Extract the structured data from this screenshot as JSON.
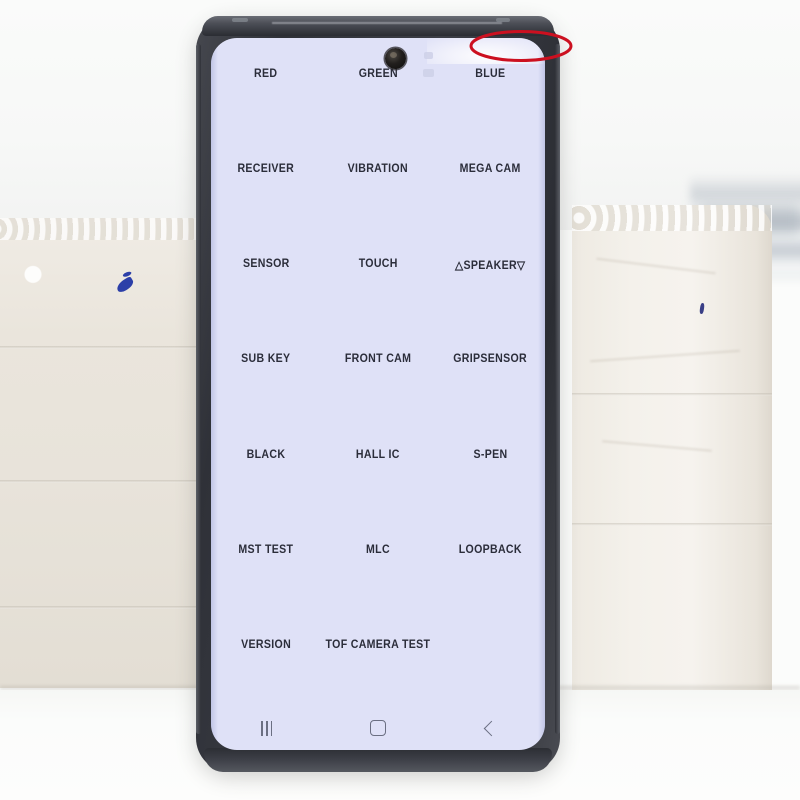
{
  "scene": {
    "description": "Samsung Galaxy Note phone held upright against white styrofoam blocks, screen showing hardware diagnostic test menu",
    "background_color": "#fbfcfb",
    "table_color": "#fdfdfc",
    "foam_color": "#eae5dc"
  },
  "phone": {
    "body_color": "#3b3d45",
    "frame_top_color": "#4b4e56",
    "screen_background": "#dfe1f7",
    "camera": {
      "name": "punch-hole-front-camera",
      "position": "top-center"
    }
  },
  "annotation": {
    "shape": "ellipse",
    "color": "#cc1020",
    "target": "display defect at top-right edge of screen",
    "stroke_width": 3
  },
  "diagnostic_menu": {
    "title": "Hardware Diagnostic Test Menu",
    "columns": 3,
    "rows": 7,
    "text_color": "#2b2d3a",
    "cell_background": "#dfe1f7",
    "items": [
      {
        "label": "RED"
      },
      {
        "label": "GREEN"
      },
      {
        "label": "BLUE"
      },
      {
        "label": "RECEIVER"
      },
      {
        "label": "VIBRATION"
      },
      {
        "label": "MEGA CAM"
      },
      {
        "label": "SENSOR"
      },
      {
        "label": "TOUCH"
      },
      {
        "label": "△SPEAKER▽"
      },
      {
        "label": "SUB KEY"
      },
      {
        "label": "FRONT CAM"
      },
      {
        "label": "GRIPSENSOR"
      },
      {
        "label": "BLACK"
      },
      {
        "label": "HALL IC"
      },
      {
        "label": "S-PEN"
      },
      {
        "label": "MST TEST"
      },
      {
        "label": "MLC"
      },
      {
        "label": "LOOPBACK"
      },
      {
        "label": "VERSION"
      },
      {
        "label": "TOF CAMERA TEST"
      },
      {
        "label": ""
      }
    ]
  },
  "navbar": {
    "color": "#6b6f82",
    "buttons": [
      {
        "name": "recents-icon",
        "label": "Recents"
      },
      {
        "name": "home-icon",
        "label": "Home"
      },
      {
        "name": "back-icon",
        "label": "Back"
      }
    ]
  }
}
